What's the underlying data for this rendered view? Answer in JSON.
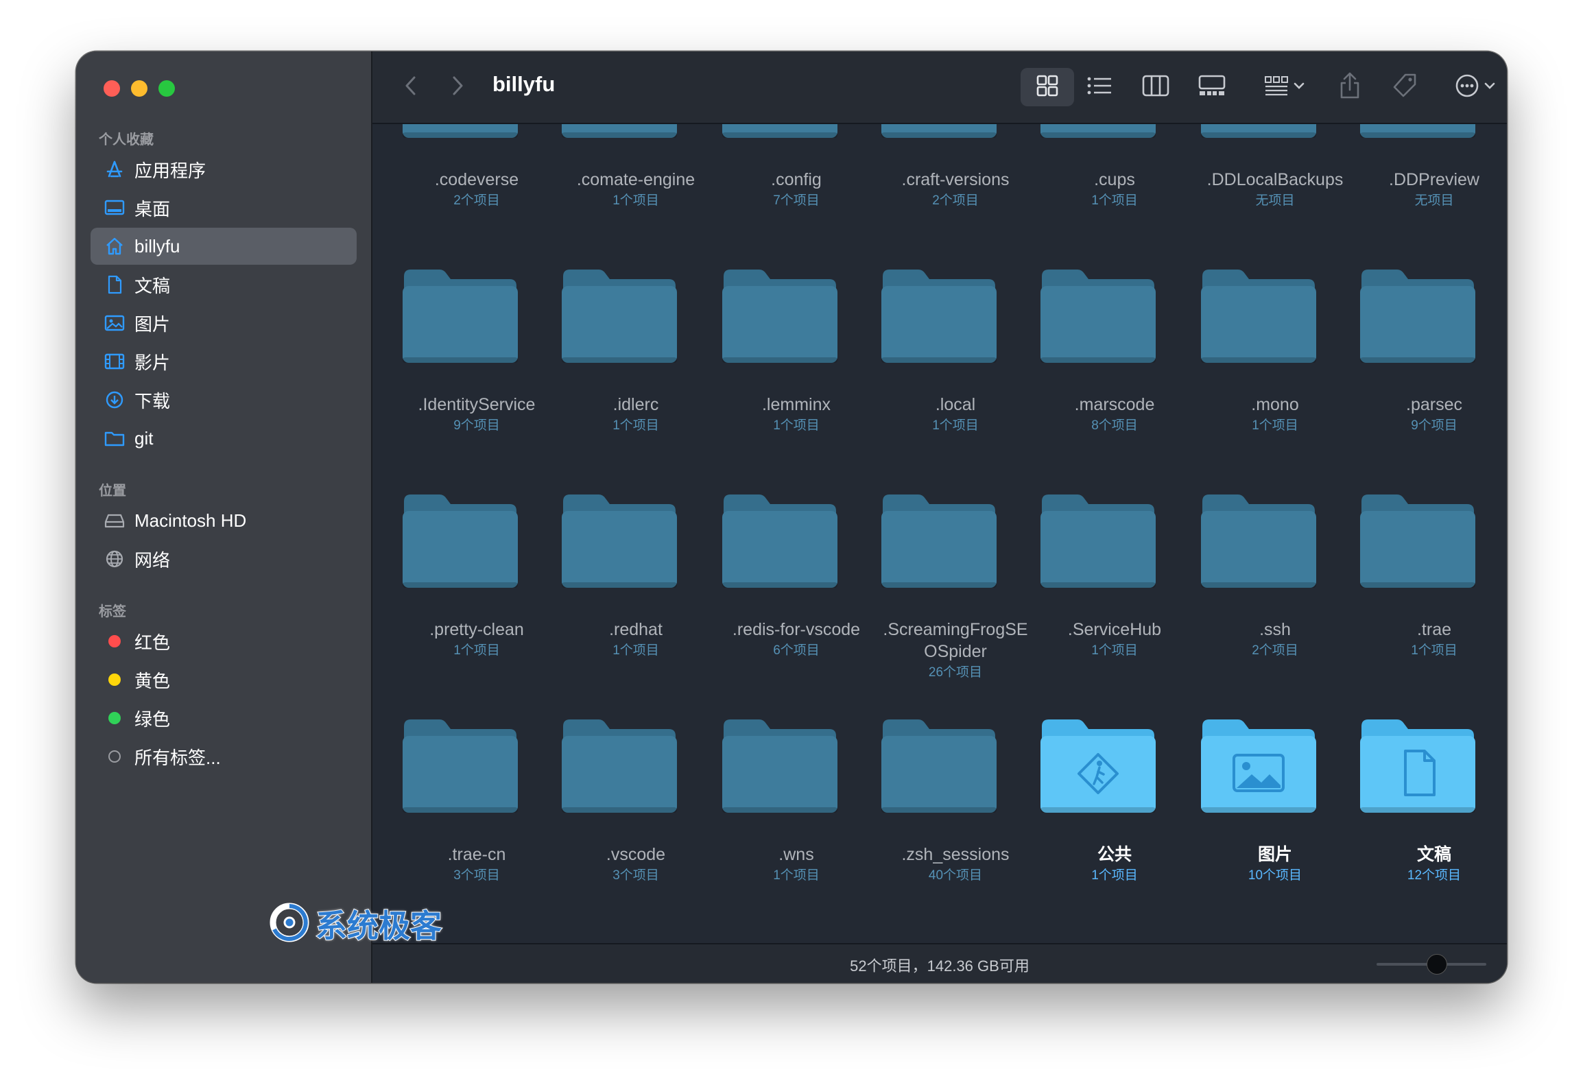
{
  "window": {
    "title": "billyfu"
  },
  "sidebar": {
    "favorites_heading": "个人收藏",
    "favorites": [
      {
        "label": "应用程序",
        "icon": "apps-icon"
      },
      {
        "label": "桌面",
        "icon": "desktop-icon"
      },
      {
        "label": "billyfu",
        "icon": "home-icon",
        "active": true
      },
      {
        "label": "文稿",
        "icon": "document-icon"
      },
      {
        "label": "图片",
        "icon": "photo-icon"
      },
      {
        "label": "影片",
        "icon": "film-icon"
      },
      {
        "label": "下载",
        "icon": "download-icon"
      },
      {
        "label": "git",
        "icon": "folder-icon"
      }
    ],
    "locations_heading": "位置",
    "locations": [
      {
        "label": "Macintosh HD",
        "icon": "disk-icon"
      },
      {
        "label": "网络",
        "icon": "network-icon"
      }
    ],
    "tags_heading": "标签",
    "tags": [
      {
        "label": "红色",
        "color": "#ff4d4d"
      },
      {
        "label": "黄色",
        "color": "#ffd60a"
      },
      {
        "label": "绿色",
        "color": "#30d158"
      },
      {
        "label": "所有标签...",
        "color": ""
      }
    ]
  },
  "toolbar": {
    "icons": [
      "back-icon",
      "forward-icon",
      "icon-view-icon",
      "list-view-icon",
      "column-view-icon",
      "gallery-view-icon",
      "group-icon",
      "share-icon",
      "tag-icon",
      "more-icon",
      "search-icon"
    ]
  },
  "folders": [
    {
      "name": ".codeverse",
      "count": "2个项目"
    },
    {
      "name": ".comate-engine",
      "count": "1个项目"
    },
    {
      "name": ".config",
      "count": "7个项目"
    },
    {
      "name": ".craft-versions",
      "count": "2个项目"
    },
    {
      "name": ".cups",
      "count": "1个项目"
    },
    {
      "name": ".DDLocalBackups",
      "count": "无项目"
    },
    {
      "name": ".DDPreview",
      "count": "无项目"
    },
    {
      "name": ".IdentityService",
      "count": "9个项目"
    },
    {
      "name": ".idlerc",
      "count": "1个项目"
    },
    {
      "name": ".lemminx",
      "count": "1个项目"
    },
    {
      "name": ".local",
      "count": "1个项目"
    },
    {
      "name": ".marscode",
      "count": "8个项目"
    },
    {
      "name": ".mono",
      "count": "1个项目"
    },
    {
      "name": ".parsec",
      "count": "9个项目"
    },
    {
      "name": ".pretty-clean",
      "count": "1个项目"
    },
    {
      "name": ".redhat",
      "count": "1个项目"
    },
    {
      "name": ".redis-for-vscode",
      "count": "6个项目"
    },
    {
      "name": ".ScreamingFrogSEOSpider",
      "name_line1": ".ScreamingFrogSE",
      "name_line2": "OSpider",
      "count": "26个项目"
    },
    {
      "name": ".ServiceHub",
      "count": "1个项目"
    },
    {
      "name": ".ssh",
      "count": "2个项目"
    },
    {
      "name": ".trae",
      "count": "1个项目"
    },
    {
      "name": ".trae-cn",
      "count": "3个项目"
    },
    {
      "name": ".vscode",
      "count": "3个项目"
    },
    {
      "name": ".wns",
      "count": "1个项目"
    },
    {
      "name": ".zsh_sessions",
      "count": "40个项目"
    },
    {
      "name": "公共",
      "count": "1个项目",
      "special": "public-icon"
    },
    {
      "name": "图片",
      "count": "10个项目",
      "special": "photo-icon"
    },
    {
      "name": "文稿",
      "count": "12个项目",
      "special": "document-icon"
    }
  ],
  "statusbar": {
    "text": "52个项目，142.36 GB可用",
    "icon_size_level": 0.55
  },
  "watermark": {
    "text": "系统极客"
  },
  "colors": {
    "hidden_folder": "#3e7c9c",
    "hidden_folder_tab": "#356e8c",
    "special_folder": "#5ec6f7",
    "special_folder_tab": "#48b4ea",
    "accent": "#0a84ff"
  }
}
